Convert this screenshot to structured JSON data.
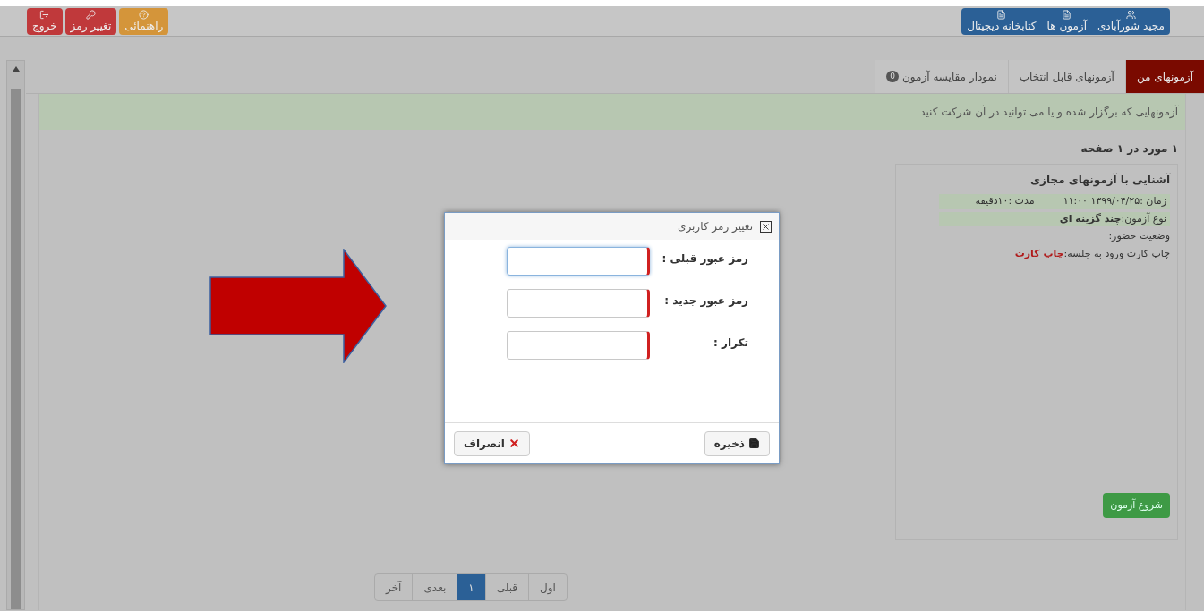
{
  "header": {
    "left_buttons": [
      {
        "label": "راهنمائی",
        "kind": "help",
        "color": "#d4953a"
      },
      {
        "label": "تغییر رمز",
        "kind": "key",
        "color": "#c0393b"
      },
      {
        "label": "خروج",
        "kind": "exit",
        "color": "#c0393b"
      }
    ],
    "right_buttons": [
      {
        "label": "مجید شورآبادی",
        "kind": "users"
      },
      {
        "label": "آزمون ها",
        "kind": "file"
      },
      {
        "label": "کتابخانه دیجیتال",
        "kind": "file"
      }
    ]
  },
  "tabs": [
    {
      "label": "آزمونهای من",
      "selected": true
    },
    {
      "label": "آزمونهای قابل انتخاب",
      "selected": false
    },
    {
      "label": "نمودار مقایسه آزمون",
      "selected": false,
      "badge": "0"
    }
  ],
  "info_bar": "آزمونهایی که برگزار شده و یا می توانید در آن شرکت کنید",
  "result_count": "۱ مورد در ۱ صفحه",
  "exam_card": {
    "title": "آشنایی با آزمونهای مجازی",
    "time": "زمان :۱۳۹۹/۰۴/۲۵ ۱۱:۰۰",
    "duration": "مدت :۱۰دقیقه",
    "type_label": "نوع آزمون:",
    "type_value": "چند گزینه ای",
    "attendance": "وضعیت حضور:",
    "card_label": "چاپ کارت ورود به جلسه:",
    "card_link": "چاپ کارت",
    "start_button": "شروع آزمون"
  },
  "pagination": [
    {
      "label": "اول",
      "selected": false
    },
    {
      "label": "قبلی",
      "selected": false
    },
    {
      "label": "۱",
      "selected": true
    },
    {
      "label": "بعدی",
      "selected": false
    },
    {
      "label": "آخر",
      "selected": false
    }
  ],
  "dialog": {
    "title": "تغییر رمز کاربری",
    "fields": [
      {
        "label": "رمز عبور قبلی :",
        "focused": true
      },
      {
        "label": "رمز عبور جدید :",
        "focused": false
      },
      {
        "label": "تکرار :",
        "focused": false
      }
    ],
    "save_button": "ذخیره",
    "cancel_button": "انصراف"
  }
}
